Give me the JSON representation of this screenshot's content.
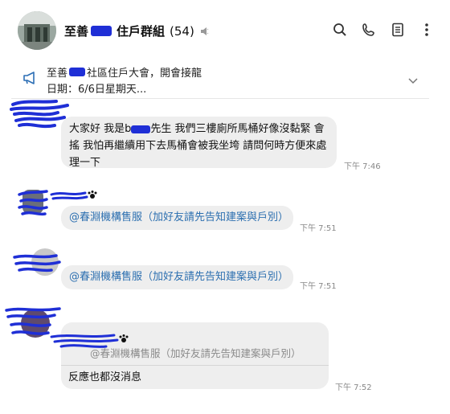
{
  "header": {
    "title_prefix": "至善",
    "title_suffix": "住戶群組",
    "member_count": "(54)",
    "icons": [
      "search-icon",
      "phone-icon",
      "notes-icon",
      "more-vertical-icon"
    ]
  },
  "announcement": {
    "line1_prefix": "至善",
    "line1_suffix": "社區住戶大會，開會接龍",
    "line2": "日期：6/6日星期天..."
  },
  "messages": [
    {
      "text_prefix": "大家好 我是b",
      "text_suffix": "先生 我們三樓廁所馬桶好像沒黏緊 會搖 我怕再繼續用下去馬桶會被我坐垮 請問何時方便來處理一下",
      "time": "下午 7:46"
    },
    {
      "mention": "@春淵機構售服（加好友請先告知建案與戶別）",
      "time": "下午 7:51"
    },
    {
      "mention": "@春淵機構售服（加好友請先告知建案與戶別）",
      "time": "下午 7:51"
    },
    {
      "reply_quote": "@春淵機構售服（加好友請先告知建案與戶別）",
      "text": "反應也都沒消息",
      "time": "下午 7:52"
    }
  ],
  "colors": {
    "bubble": "#eeeeee",
    "mention": "#2c6fb0",
    "redaction": "#1f2fd6",
    "time": "#888888"
  }
}
